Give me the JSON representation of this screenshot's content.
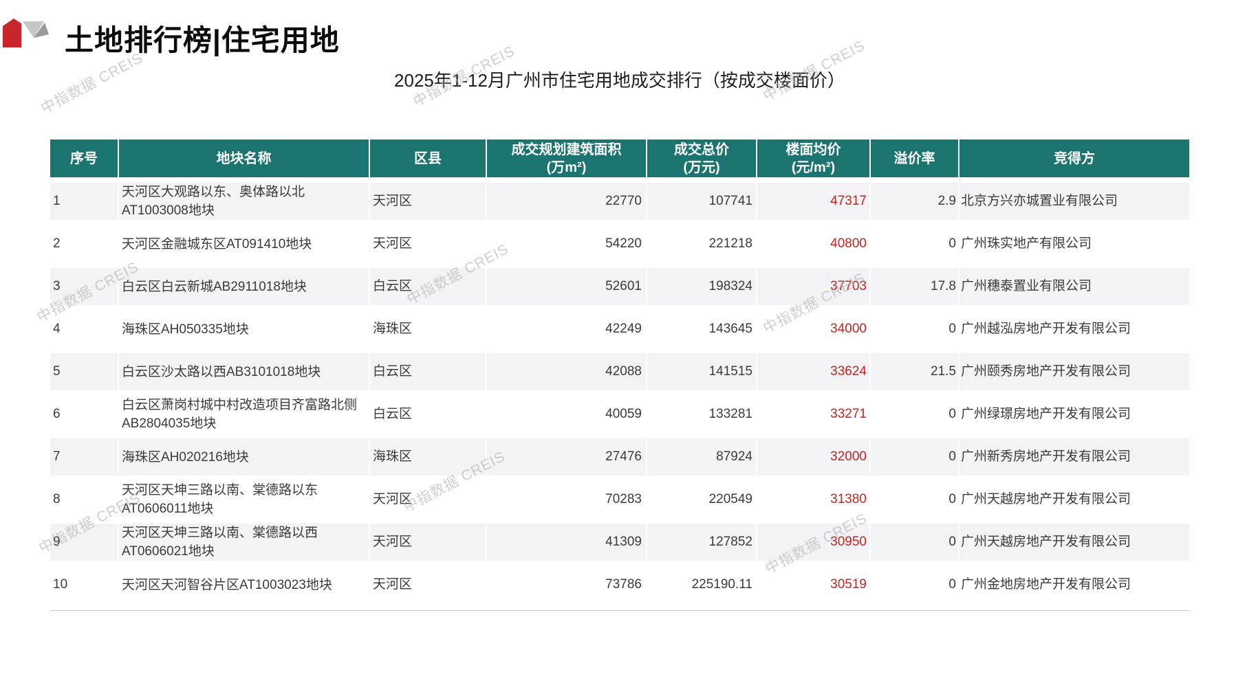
{
  "header": {
    "title": "土地排行榜|住宅用地",
    "subtitle": "2025年1-12月广州市住宅用地成交排行（按成交楼面价）"
  },
  "watermark": {
    "text": "中指数据 CREIS"
  },
  "logo": {
    "name": "creis-logo",
    "red": "#C8252C",
    "gray_light": "#C6C6C8",
    "gray_dark": "#99999B"
  },
  "colors": {
    "header_bg": "#1B7470",
    "floor_price_red": "#C4241E",
    "row_alt_bg": "#F3F3F5",
    "header_text": "#FFFFFF"
  },
  "table": {
    "columns": [
      {
        "label": "序号",
        "unit": ""
      },
      {
        "label": "地块名称",
        "unit": ""
      },
      {
        "label": "区县",
        "unit": ""
      },
      {
        "label": "成交规划建筑面积",
        "unit": "(万m²)"
      },
      {
        "label": "成交总价",
        "unit": "(万元)"
      },
      {
        "label": "楼面均价",
        "unit": "(元/m²)"
      },
      {
        "label": "溢价率",
        "unit": ""
      },
      {
        "label": "竞得方",
        "unit": ""
      }
    ],
    "rows": [
      {
        "no": "1",
        "plot": "天河区大观路以东、奥体路以北AT1003008地块",
        "district": "天河区",
        "area": "22770",
        "total_price": "107741",
        "floor_price": "47317",
        "premium": "2.9",
        "winner": "北京方兴亦城置业有限公司"
      },
      {
        "no": "2",
        "plot": "天河区金融城东区AT091410地块",
        "district": "天河区",
        "area": "54220",
        "total_price": "221218",
        "floor_price": "40800",
        "premium": "0",
        "winner": "广州珠实地产有限公司"
      },
      {
        "no": "3",
        "plot": "白云区白云新城AB2911018地块",
        "district": "白云区",
        "area": "52601",
        "total_price": "198324",
        "floor_price": "37703",
        "premium": "17.8",
        "winner": "广州穗泰置业有限公司"
      },
      {
        "no": "4",
        "plot": "海珠区AH050335地块",
        "district": "海珠区",
        "area": "42249",
        "total_price": "143645",
        "floor_price": "34000",
        "premium": "0",
        "winner": "广州越泓房地产开发有限公司"
      },
      {
        "no": "5",
        "plot": "白云区沙太路以西AB3101018地块",
        "district": "白云区",
        "area": "42088",
        "total_price": "141515",
        "floor_price": "33624",
        "premium": "21.5",
        "winner": "广州颐秀房地产开发有限公司"
      },
      {
        "no": "6",
        "plot": "白云区萧岗村城中村改造项目齐富路北侧AB2804035地块",
        "district": "白云区",
        "area": "40059",
        "total_price": "133281",
        "floor_price": "33271",
        "premium": "0",
        "winner": "广州绿璟房地产开发有限公司"
      },
      {
        "no": "7",
        "plot": "海珠区AH020216地块",
        "district": "海珠区",
        "area": "27476",
        "total_price": "87924",
        "floor_price": "32000",
        "premium": "0",
        "winner": "广州新秀房地产开发有限公司"
      },
      {
        "no": "8",
        "plot": "天河区天坤三路以南、棠德路以东AT0606011地块",
        "district": "天河区",
        "area": "70283",
        "total_price": "220549",
        "floor_price": "31380",
        "premium": "0",
        "winner": "广州天越房地产开发有限公司"
      },
      {
        "no": "9",
        "plot": "天河区天坤三路以南、棠德路以西AT0606021地块",
        "district": "天河区",
        "area": "41309",
        "total_price": "127852",
        "floor_price": "30950",
        "premium": "0",
        "winner": "广州天越房地产开发有限公司"
      },
      {
        "no": "10",
        "plot": "天河区天河智谷片区AT1003023地块",
        "district": "天河区",
        "area": "73786",
        "total_price": "225190.11",
        "floor_price": "30519",
        "premium": "0",
        "winner": "广州金地房地产开发有限公司"
      }
    ]
  }
}
